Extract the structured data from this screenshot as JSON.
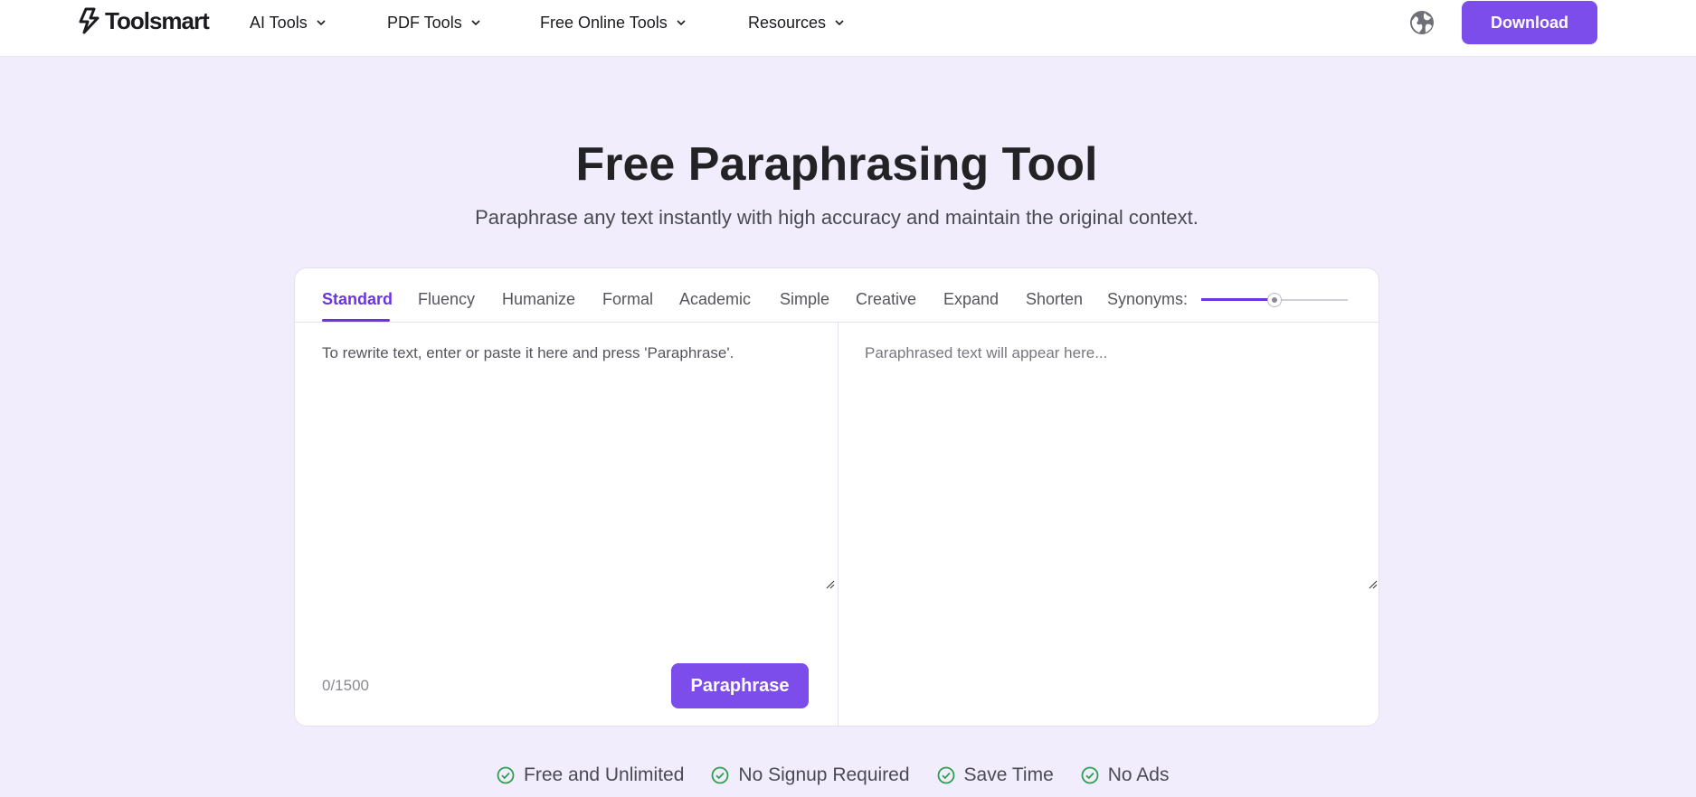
{
  "header": {
    "logo_text": "Toolsmart",
    "nav": [
      {
        "label": "AI Tools"
      },
      {
        "label": "PDF Tools"
      },
      {
        "label": "Free Online Tools"
      },
      {
        "label": "Resources"
      }
    ],
    "download_label": "Download"
  },
  "hero": {
    "title": "Free Paraphrasing Tool",
    "subtitle": "Paraphrase any text instantly with high accuracy and maintain the original context."
  },
  "tool": {
    "modes": [
      {
        "label": "Standard",
        "active": true
      },
      {
        "label": "Fluency",
        "active": false
      },
      {
        "label": "Humanize",
        "active": false
      },
      {
        "label": "Formal",
        "active": false
      },
      {
        "label": "Academic",
        "active": false
      },
      {
        "label": "Simple",
        "active": false
      },
      {
        "label": "Creative",
        "active": false
      },
      {
        "label": "Expand",
        "active": false
      },
      {
        "label": "Shorten",
        "active": false
      }
    ],
    "synonyms_label": "Synonyms:",
    "synonyms_level": 0.5,
    "input_placeholder": "To rewrite text, enter or paste it here and press 'Paraphrase'.",
    "output_placeholder": "Paraphrased text will appear here...",
    "counter": "0/1500",
    "paraphrase_label": "Paraphrase"
  },
  "features": [
    {
      "label": "Free and Unlimited"
    },
    {
      "label": "No Signup Required"
    },
    {
      "label": "Save Time"
    },
    {
      "label": "No Ads"
    }
  ],
  "colors": {
    "accent": "#7c4dea",
    "active_tab": "#6a35e0",
    "background": "#f1edfd",
    "check_green": "#2e9e4f"
  }
}
